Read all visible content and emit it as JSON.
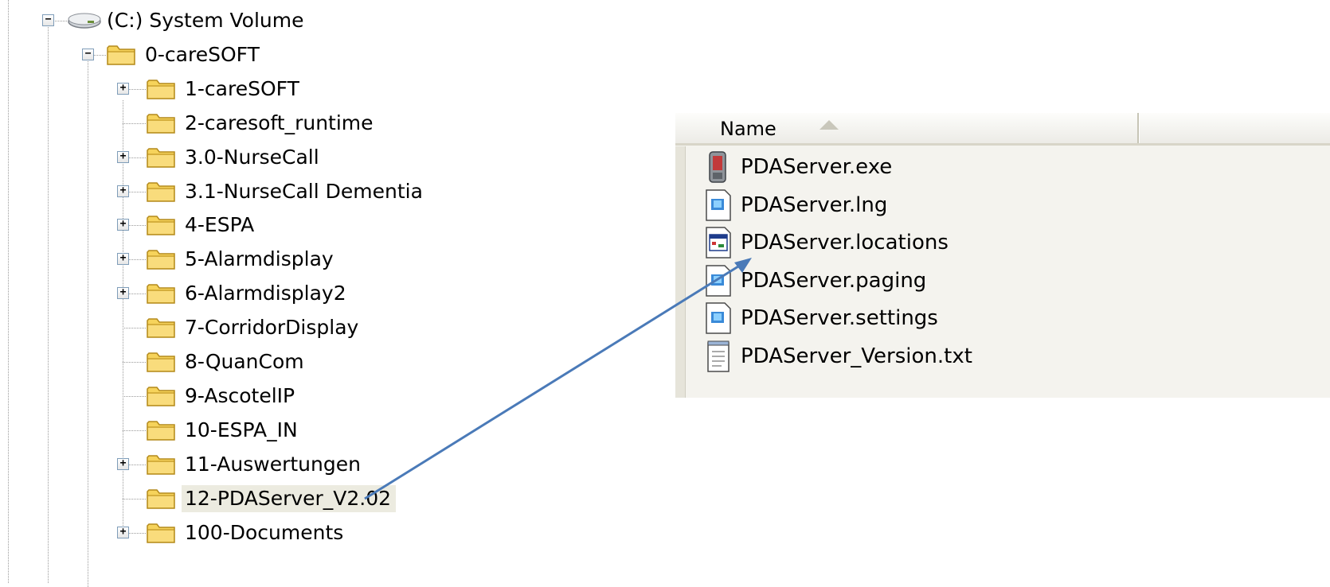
{
  "tree": {
    "drive": {
      "label": "(C:) System Volume",
      "expander": "⊟",
      "icon": "hard-drive-icon"
    },
    "root_folder": {
      "label": "0-careSOFT",
      "expander": "⊟",
      "icon": "folder-icon"
    },
    "children": [
      {
        "label": "1-careSOFT",
        "expandable": true,
        "expander": "+"
      },
      {
        "label": "2-caresoft_runtime",
        "expandable": false
      },
      {
        "label": "3.0-NurseCall",
        "expandable": true,
        "expander": "+"
      },
      {
        "label": "3.1-NurseCall Dementia",
        "expandable": true,
        "expander": "+"
      },
      {
        "label": "4-ESPA",
        "expandable": true,
        "expander": "+"
      },
      {
        "label": "5-Alarmdisplay",
        "expandable": true,
        "expander": "+"
      },
      {
        "label": "6-Alarmdisplay2",
        "expandable": true,
        "expander": "+"
      },
      {
        "label": "7-CorridorDisplay",
        "expandable": false
      },
      {
        "label": "8-QuanCom",
        "expandable": false
      },
      {
        "label": "9-AscotelIP",
        "expandable": false
      },
      {
        "label": "10-ESPA_IN",
        "expandable": false
      },
      {
        "label": "11-Auswertungen",
        "expandable": true,
        "expander": "+"
      },
      {
        "label": "12-PDAServer_V2.02",
        "expandable": false,
        "selected": true
      },
      {
        "label": "100-Documents",
        "expandable": true,
        "expander": "+"
      }
    ]
  },
  "file_list": {
    "column_header": {
      "name_label": "Name",
      "sort": "ascending"
    },
    "files": [
      {
        "name": "PDAServer.exe",
        "icon": "executable-icon"
      },
      {
        "name": "PDAServer.lng",
        "icon": "generic-file-icon"
      },
      {
        "name": "PDAServer.locations",
        "icon": "application-window-icon"
      },
      {
        "name": "PDAServer.paging",
        "icon": "generic-file-icon"
      },
      {
        "name": "PDAServer.settings",
        "icon": "generic-file-icon"
      },
      {
        "name": "PDAServer_Version.txt",
        "icon": "notepad-text-icon"
      }
    ]
  },
  "annotation": {
    "arrow_color": "#4a7ab8",
    "from": "12-PDAServer_V2.02",
    "to": "PDAServer.locations"
  },
  "colors": {
    "folder_fill": "#f6d35b",
    "folder_stroke": "#b48a1c",
    "selection_bg": "#ecebe0",
    "list_bg": "#f4f3ee"
  }
}
